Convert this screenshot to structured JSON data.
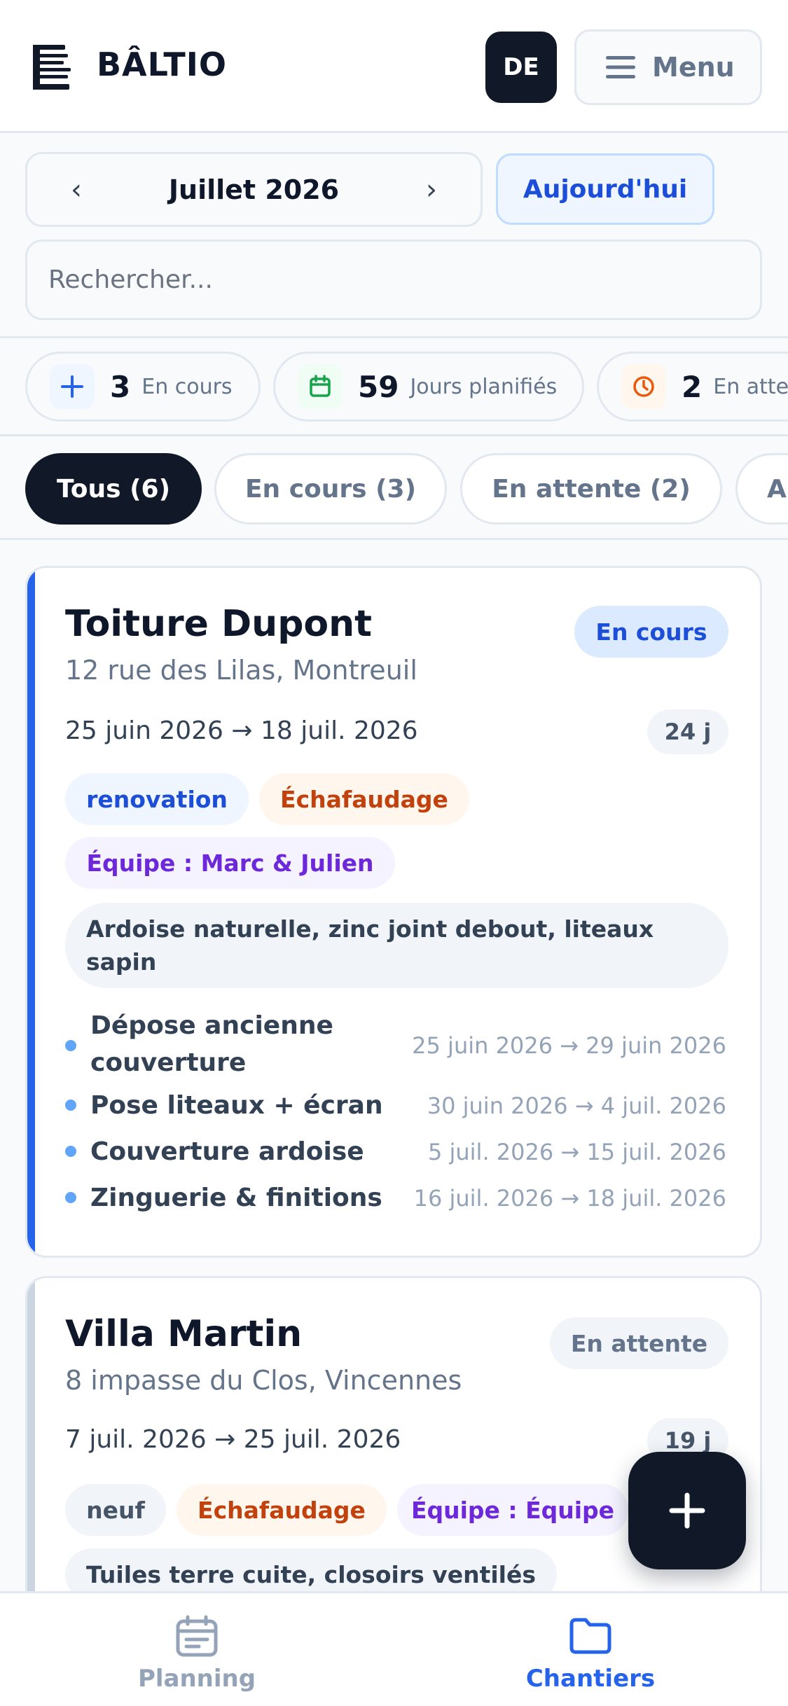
{
  "header": {
    "brand": "BÂLTIO",
    "language": "DE",
    "menu_label": "Menu"
  },
  "calendar": {
    "month_label": "Juillet 2026",
    "prev": "‹",
    "next": "›",
    "today_label": "Aujourd'hui"
  },
  "search": {
    "placeholder": "Rechercher..."
  },
  "stats": [
    {
      "value": "3",
      "label": "En cours",
      "icon": "plus-icon",
      "color": "#2563eb"
    },
    {
      "value": "59",
      "label": "Jours planifiés",
      "icon": "calendar-icon",
      "color": "#16a34a"
    },
    {
      "value": "2",
      "label": "En attente",
      "icon": "clock-icon",
      "color": "#ea580c"
    }
  ],
  "filters": [
    {
      "label": "Tous (6)",
      "active": true
    },
    {
      "label": "En cours (3)",
      "active": false
    },
    {
      "label": "En attente (2)",
      "active": false
    },
    {
      "label": "A",
      "active": false
    }
  ],
  "projects": [
    {
      "title": "Toiture Dupont",
      "address": "12 rue des Lilas, Montreuil",
      "status": "En cours",
      "dates": "25 juin 2026 → 18 juil. 2026",
      "duration": "24 j",
      "tags": [
        "renovation",
        "Échafaudage",
        "Équipe : Marc & Julien"
      ],
      "materials": "Ardoise naturelle, zinc joint debout, liteaux sapin",
      "phases": [
        {
          "name": "Dépose ancienne couverture",
          "dates": "25 juin 2026 → 29 juin 2026"
        },
        {
          "name": "Pose liteaux + écran",
          "dates": "30 juin 2026 → 4 juil. 2026"
        },
        {
          "name": "Couverture ardoise",
          "dates": "5 juil. 2026 → 15 juil. 2026"
        },
        {
          "name": "Zinguerie & finitions",
          "dates": "16 juil. 2026 → 18 juil. 2026"
        }
      ],
      "accent": "#2563eb"
    },
    {
      "title": "Villa Martin",
      "address": "8 impasse du Clos, Vincennes",
      "status": "En attente",
      "dates": "7 juil. 2026 → 25 juil. 2026",
      "duration": "19 j",
      "tags": [
        "neuf",
        "Échafaudage",
        "Équipe : Équipe"
      ],
      "materials": "Tuiles terre cuite, closoirs ventilés",
      "accent": "#cbd5e1"
    }
  ],
  "fab": {
    "icon": "plus-icon"
  },
  "nav": [
    {
      "label": "Planning",
      "icon": "calendar-icon",
      "active": false
    },
    {
      "label": "Chantiers",
      "icon": "folder-icon",
      "active": true
    }
  ]
}
